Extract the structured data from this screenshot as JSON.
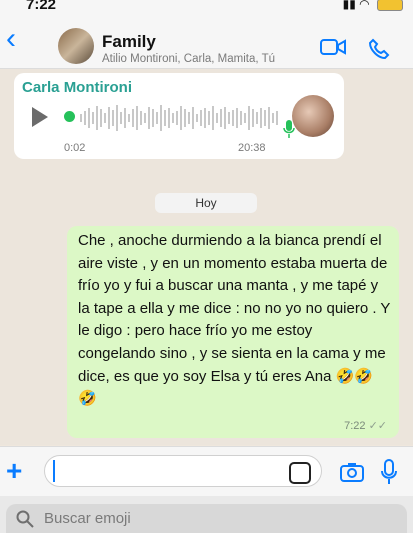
{
  "status": {
    "time": "7:22"
  },
  "header": {
    "back_label": "‹",
    "title": "Family",
    "subtitle": "Atilio Montironi, Carla, Mamita, Tú"
  },
  "voice_message": {
    "sender": "Carla Montironi",
    "elapsed": "0:02",
    "duration": "20:38"
  },
  "day_separator": "Hoy",
  "message": {
    "text": "Che , anoche durmiendo a la bianca prendí el aire viste , y en un momento estaba muerta de frío yo y fui a buscar una manta , y me tapé y la tape a ella y me dice : no no yo no quiero . Y le digo : pero hace frío yo me estoy congelando sino , y se sienta en la cama y me dice, es que yo soy Elsa y tú eres Ana 🤣🤣 🤣",
    "time": "7:22",
    "ticks": "✓✓"
  },
  "input": {
    "plus_label": "+"
  },
  "emoji_search": {
    "placeholder": "Buscar emoji"
  },
  "icons": {
    "video": "video-call-icon",
    "call": "phone-icon",
    "camera": "camera-icon",
    "mic": "microphone-icon",
    "sticker": "sticker-icon",
    "search": "search-icon",
    "play": "play-icon"
  },
  "colors": {
    "accent": "#0a7cff",
    "bubble_out": "#dcf8c6",
    "sender": "#2aa093"
  }
}
